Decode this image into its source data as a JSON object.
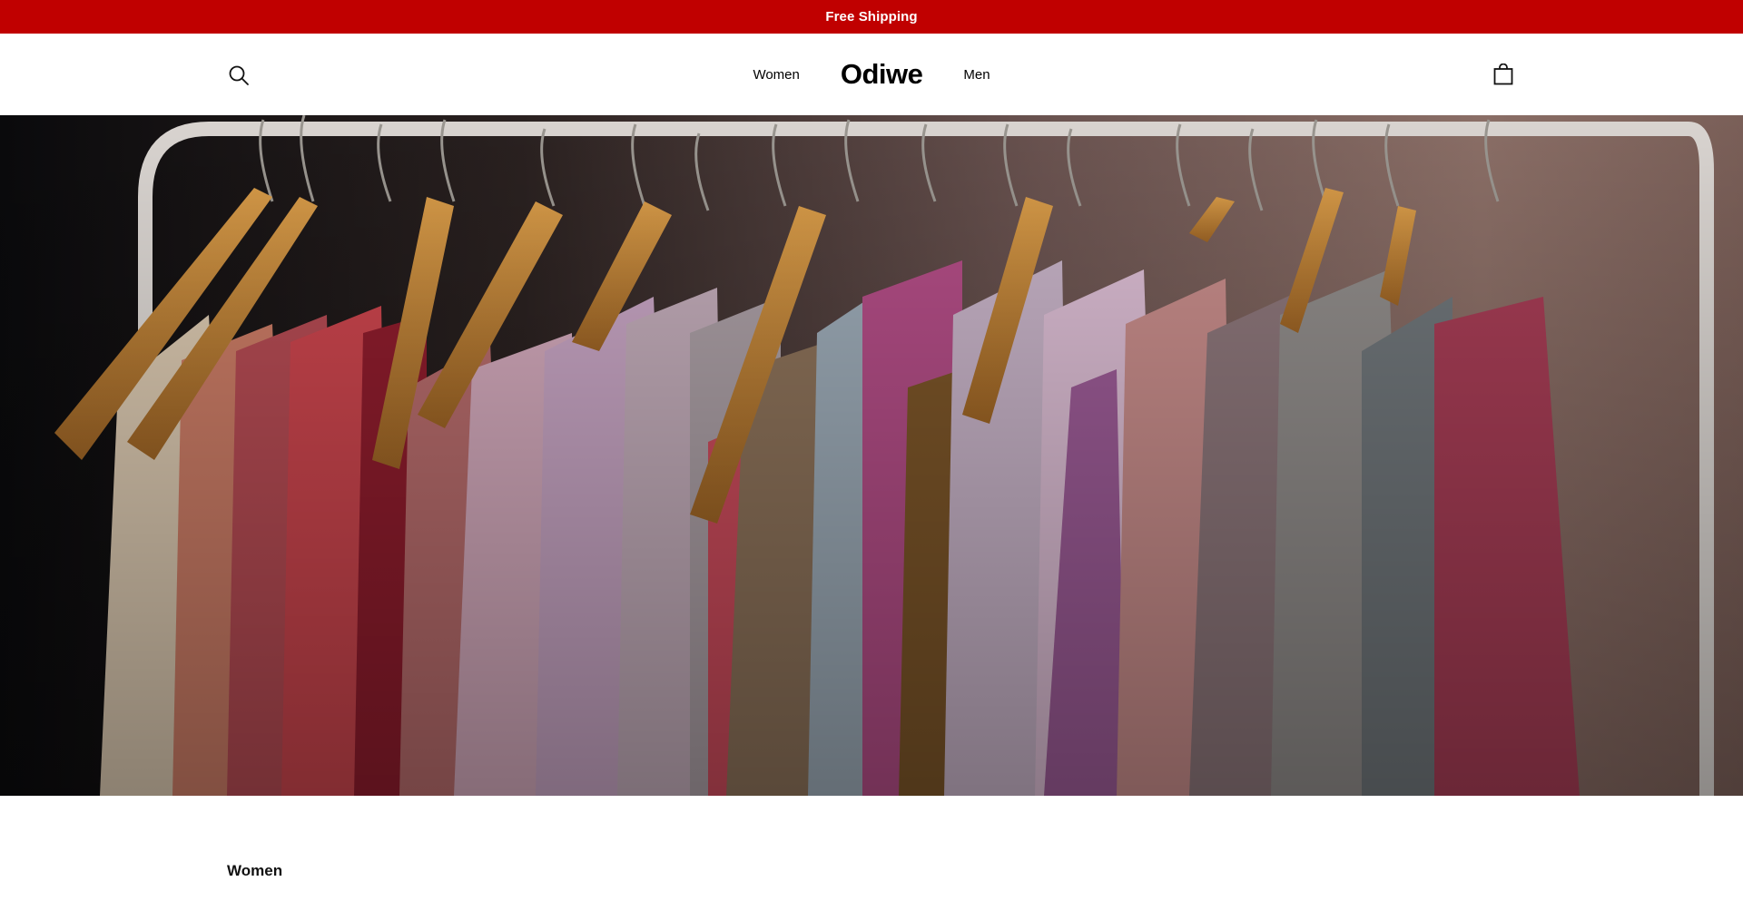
{
  "announcement": {
    "text": "Free Shipping",
    "background": "#c00000"
  },
  "header": {
    "brand": "Odiwe",
    "nav": [
      {
        "label": "Women"
      },
      {
        "label": "Men"
      }
    ],
    "search_icon": "search-icon",
    "cart_icon": "shopping-bag-icon"
  },
  "hero": {
    "image": "clothing-rack-photo"
  },
  "section": {
    "title": "Women"
  }
}
